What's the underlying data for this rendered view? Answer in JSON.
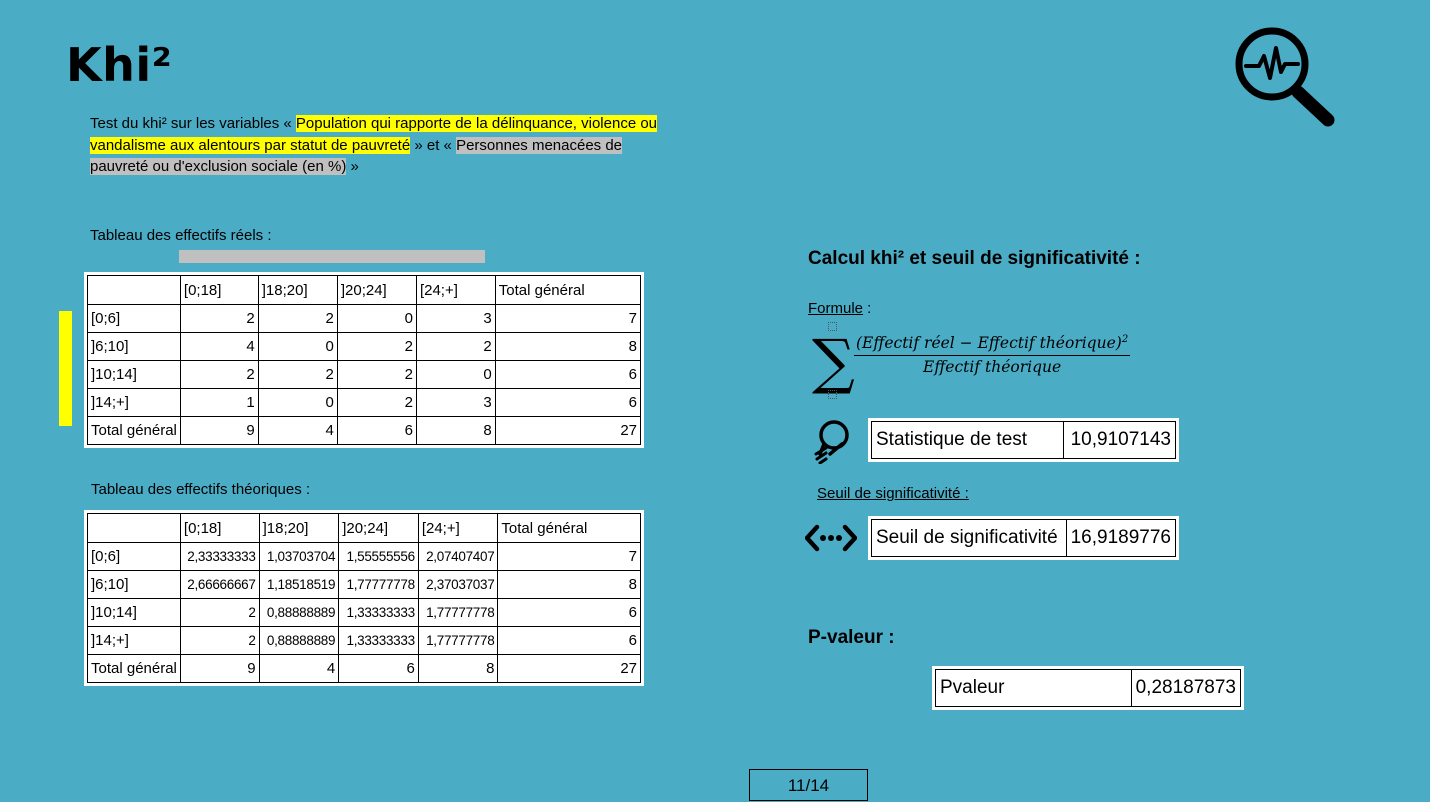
{
  "slide": {
    "title": "Khi²",
    "intro": {
      "part1": "Test du khi² sur les variables « ",
      "var1": "Population qui rapporte de la délinquance, violence ou vandalisme aux alentours par statut de pauvreté",
      "part2": " » et « ",
      "var2": "Personnes menacées de pauvreté ou d'exclusion sociale (en %)",
      "part3": " »"
    },
    "page_indicator": "11/14",
    "icons": [
      "magnifier-pulse-icon",
      "lightbulb-icon",
      "arrows-dots-icon"
    ],
    "colors": {
      "background": "#4bacc6",
      "highlight_yellow": "#ffff00",
      "highlight_gray": "#c0c0c0"
    }
  },
  "observed": {
    "label": "Tableau des effectifs réels :",
    "columns": [
      "",
      "[0;18]",
      "]18;20]",
      "]20;24]",
      "[24;+]",
      "Total général"
    ],
    "rows": [
      [
        "[0;6]",
        "2",
        "2",
        "0",
        "3",
        "7"
      ],
      [
        "]6;10]",
        "4",
        "0",
        "2",
        "2",
        "8"
      ],
      [
        "]10;14]",
        "2",
        "2",
        "2",
        "0",
        "6"
      ],
      [
        "]14;+]",
        "1",
        "0",
        "2",
        "3",
        "6"
      ],
      [
        "Total général",
        "9",
        "4",
        "6",
        "8",
        "27"
      ]
    ]
  },
  "expected": {
    "label": "Tableau des effectifs théoriques :",
    "columns": [
      "",
      "[0;18]",
      "]18;20]",
      "]20;24]",
      "[24;+]",
      "Total général"
    ],
    "rows": [
      [
        "[0;6]",
        "2,33333333",
        "1,03703704",
        "1,55555556",
        "2,07407407",
        "7"
      ],
      [
        "]6;10]",
        "2,66666667",
        "1,18518519",
        "1,77777778",
        "2,37037037",
        "8"
      ],
      [
        "]10;14]",
        "2",
        "0,88888889",
        "1,33333333",
        "1,77777778",
        "6"
      ],
      [
        "]14;+]",
        "2",
        "0,88888889",
        "1,33333333",
        "1,77777778",
        "6"
      ],
      [
        "Total général",
        "9",
        "4",
        "6",
        "8",
        "27"
      ]
    ]
  },
  "calc": {
    "title": "Calcul khi² et seuil de significativité :",
    "formula_label": "Formule",
    "formula_colon": " :",
    "formula_numerator": "(Effectif réel − Effectif théorique)",
    "formula_exponent": "2",
    "formula_denominator": "Effectif théorique",
    "sigma": "∑",
    "test_stat_label": "Statistique de test",
    "test_stat_value": "10,9107143",
    "threshold_section": "Seuil de significativité :",
    "threshold_label": "Seuil de significativité",
    "threshold_value": "16,9189776"
  },
  "pvalue": {
    "title": "P-valeur :",
    "label": "Pvaleur",
    "value": "0,28187873"
  }
}
